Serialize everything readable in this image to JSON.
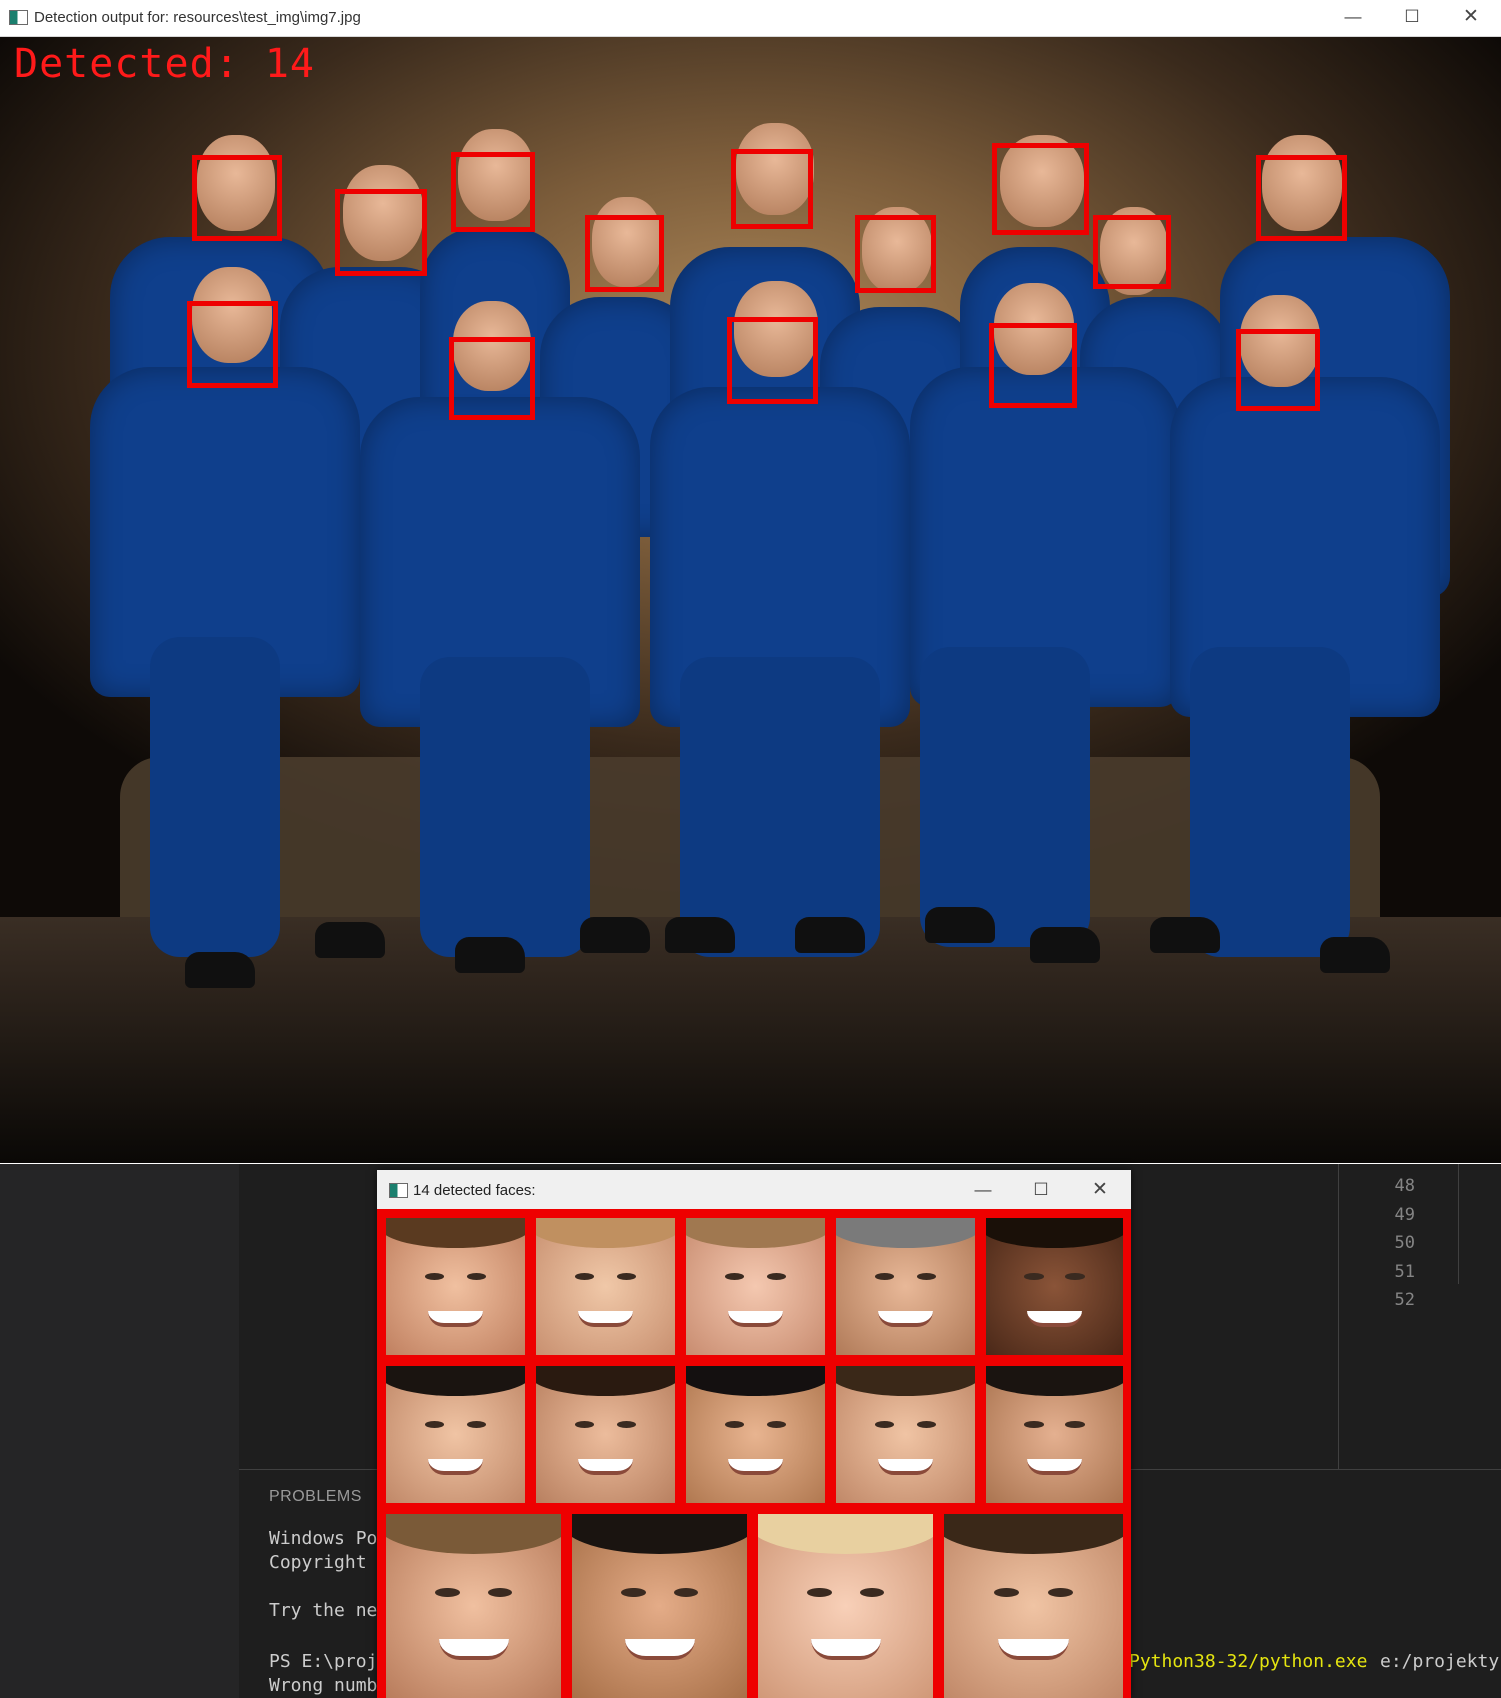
{
  "detection_window": {
    "title": "Detection output for: resources\\test_img\\img7.jpg",
    "overlay_text": "Detected: 14",
    "box_color": "#ee0000",
    "controls": {
      "minimize": "—",
      "maximize": "☐",
      "close": "✕"
    }
  },
  "faces_window": {
    "title": "14 detected faces:",
    "controls": {
      "minimize": "—",
      "maximize": "☐",
      "close": "✕"
    },
    "thumbnail_count": 14,
    "grid_rows": [
      5,
      5,
      4
    ]
  },
  "editor": {
    "line_numbers": [
      "48",
      "49",
      "50",
      "51",
      "52"
    ],
    "panel_title": "PROBLEMS",
    "terminal": {
      "line1": "Windows Po",
      "line2": "Copyright",
      "line3": "Try the ne",
      "line4": "PS E:\\proj",
      "line5": "Wrong numb",
      "command_yellow": "Python38-32/python.exe",
      "command_white": "e:/projekty"
    }
  }
}
